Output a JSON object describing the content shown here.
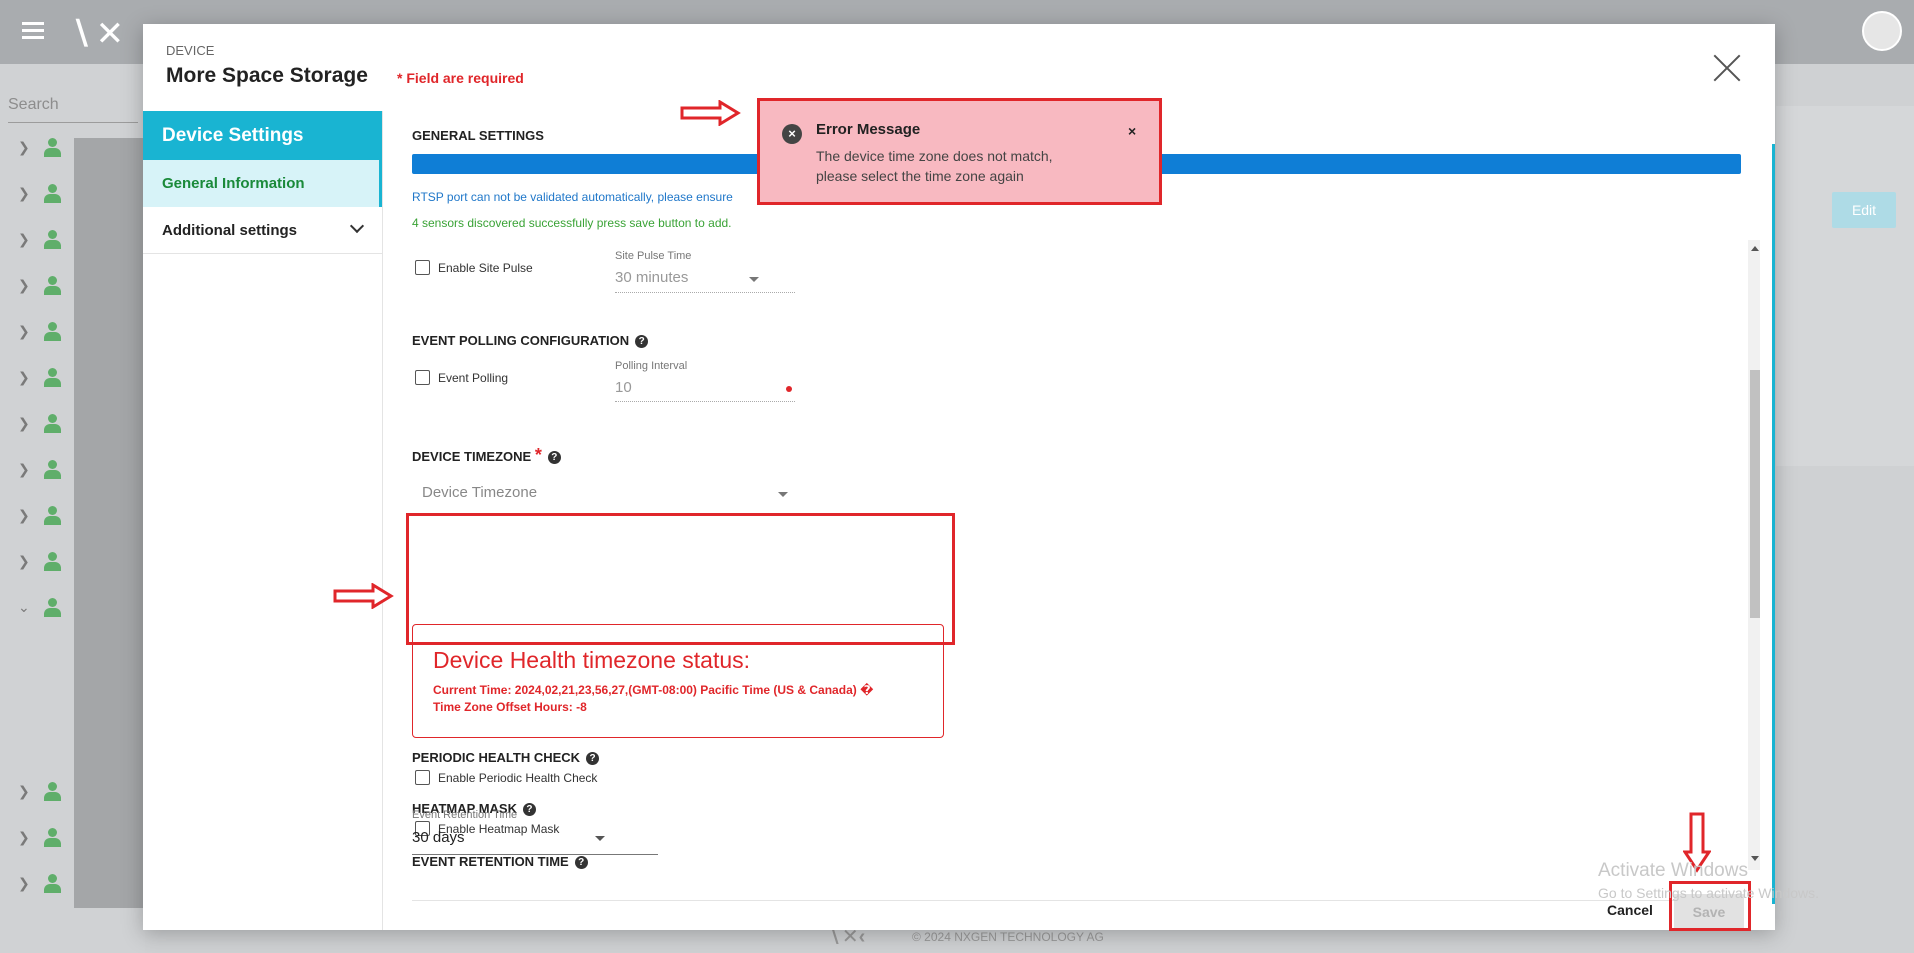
{
  "background": {
    "search_placeholder": "Search",
    "edit_label": "Edit",
    "footer": "© 2024 NXGEN TECHNOLOGY AG"
  },
  "modal": {
    "subtitle": "DEVICE",
    "title": "More Space Storage",
    "required_note": "* Field are required"
  },
  "menu": {
    "header": "Device Settings",
    "items": [
      {
        "label": "General Information"
      },
      {
        "label": "Additional settings"
      }
    ]
  },
  "content": {
    "general_settings_title": "GENERAL SETTINGS",
    "rtsp_info": "RTSP port can not be validated automatically, please ensure",
    "sensors_info": "4 sensors discovered successfully press save button to add.",
    "site_pulse": {
      "checkbox_label": "Enable Site Pulse",
      "field_label": "Site Pulse Time",
      "value": "30 minutes"
    },
    "event_polling": {
      "title": "EVENT POLLING CONFIGURATION",
      "checkbox_label": "Event Polling",
      "field_label": "Polling Interval",
      "value": "10"
    },
    "device_timezone": {
      "title": "DEVICE TIMEZONE",
      "required_mark": "*",
      "placeholder": "Device Timezone"
    },
    "health_status": {
      "title": "Device Health timezone status:",
      "current_time": "Current Time: 2024,02,21,23,56,27,(GMT-08:00) Pacific Time (US & Canada) �",
      "offset": "Time Zone Offset Hours: -8"
    },
    "periodic_health": {
      "title": "PERIODIC HEALTH CHECK",
      "checkbox_label": "Enable Periodic Health Check"
    },
    "heatmap": {
      "title": "HEATMAP MASK",
      "checkbox_label": "Enable Heatmap Mask"
    },
    "event_retention": {
      "title": "EVENT RETENTION TIME",
      "field_label": "Event Retention Time",
      "value": "30 days"
    }
  },
  "footer_buttons": {
    "cancel": "Cancel",
    "save": "Save"
  },
  "toast": {
    "title": "Error Message",
    "close": "×",
    "line1": "The device time zone does not match,",
    "line2": "please select the time zone again"
  },
  "watermark": {
    "line1": "Activate Windows",
    "line2": "Go to Settings to activate Windows."
  },
  "colors": {
    "accent": "#19b4d2",
    "error": "#e0262a",
    "progress": "#0f7ed6"
  }
}
